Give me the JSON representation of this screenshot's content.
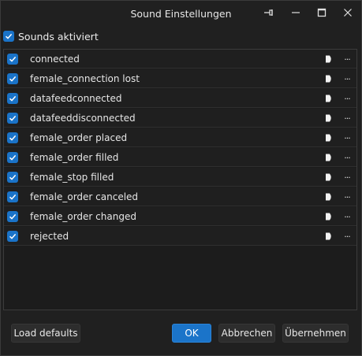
{
  "window": {
    "title": "Sound Einstellungen",
    "icons": [
      "pin-icon",
      "minimize-icon",
      "maximize-icon",
      "close-icon"
    ]
  },
  "master": {
    "label": "Sounds aktiviert",
    "checked": true
  },
  "sounds": [
    {
      "label": "connected",
      "checked": true
    },
    {
      "label": "female_connection lost",
      "checked": true
    },
    {
      "label": "datafeedconnected",
      "checked": true
    },
    {
      "label": "datafeeddisconnected",
      "checked": true
    },
    {
      "label": "female_order placed",
      "checked": true
    },
    {
      "label": "female_order filled",
      "checked": true
    },
    {
      "label": "female_stop filled",
      "checked": true
    },
    {
      "label": "female_order canceled",
      "checked": true
    },
    {
      "label": "female_order changed",
      "checked": true
    },
    {
      "label": "rejected",
      "checked": true
    }
  ],
  "row_more_label": "...",
  "buttons": {
    "load_defaults": "Load defaults",
    "ok": "OK",
    "cancel": "Abbrechen",
    "apply": "Übernehmen"
  },
  "colors": {
    "accent": "#1b74c9",
    "background": "#202020"
  }
}
